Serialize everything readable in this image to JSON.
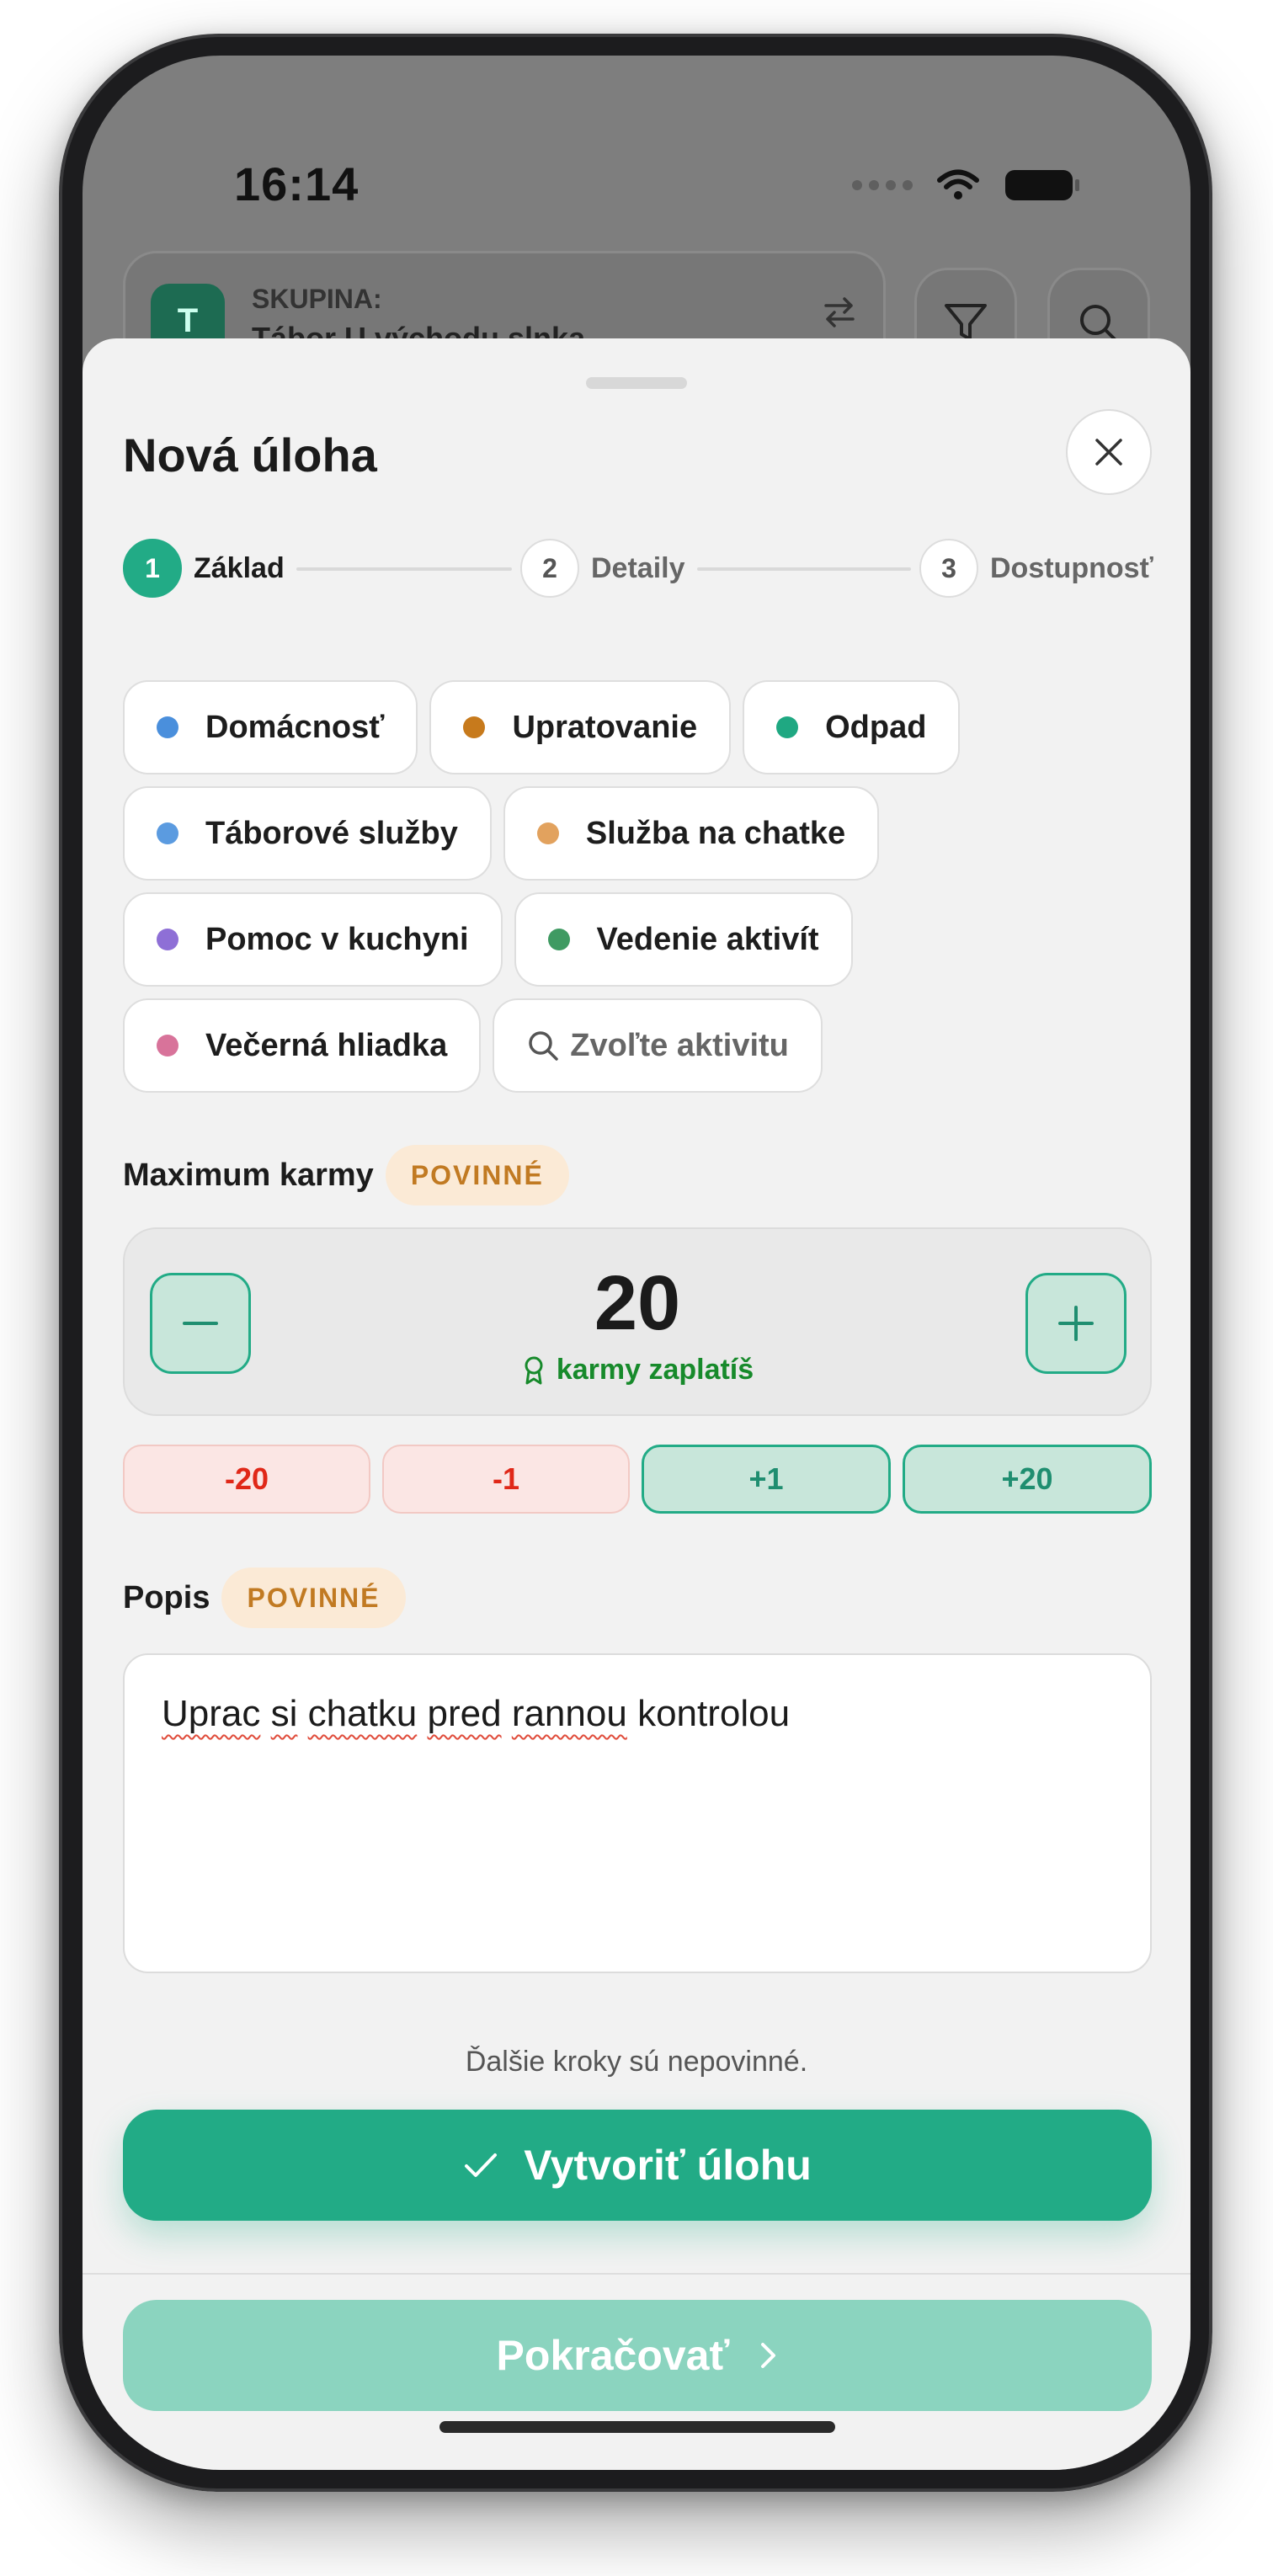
{
  "status_bar": {
    "time": "16:14"
  },
  "background": {
    "group_label": "SKUPINA:",
    "group_name": "Tábor U východu slnka",
    "group_avatar_letter": "T"
  },
  "sheet": {
    "title": "Nová úloha",
    "steps": [
      {
        "number": "1",
        "label": "Základ",
        "active": true
      },
      {
        "number": "2",
        "label": "Detaily",
        "active": false
      },
      {
        "number": "3",
        "label": "Dostupnosť",
        "active": false
      }
    ],
    "categories": [
      {
        "label": "Domácnosť",
        "color": "#4a8fdc"
      },
      {
        "label": "Upratovanie",
        "color": "#c77a1c"
      },
      {
        "label": "Odpad",
        "color": "#1fa882"
      },
      {
        "label": "Táborové služby",
        "color": "#5b9be0"
      },
      {
        "label": "Služba na chatke",
        "color": "#e2a25e"
      },
      {
        "label": "Pomoc v kuchyni",
        "color": "#8e6fd6"
      },
      {
        "label": "Vedenie aktivít",
        "color": "#3f9a62"
      },
      {
        "label": "Večerná hliadka",
        "color": "#d8739a"
      }
    ],
    "category_search_placeholder": "Zvoľte aktivitu",
    "karma": {
      "label": "Maximum karmy",
      "required_badge": "POVINNÉ",
      "value": "20",
      "caption": "karmy zaplatíš",
      "quick": [
        "-20",
        "-1",
        "+1",
        "+20"
      ]
    },
    "description": {
      "label": "Popis",
      "required_badge": "POVINNÉ",
      "value_words": [
        "Uprac",
        "si",
        "chatku",
        "pred",
        "rannou"
      ],
      "value_tail": "kontrolou"
    },
    "hint": "Ďalšie kroky sú nepovinné.",
    "create_label": "Vytvoriť úlohu",
    "continue_label": "Pokračovať"
  },
  "colors": {
    "accent": "#22ab86",
    "accent_light": "#8bd4bf",
    "warning_badge_bg": "#fbead6",
    "warning_badge_text": "#c17a22",
    "negative": "#e02818"
  }
}
